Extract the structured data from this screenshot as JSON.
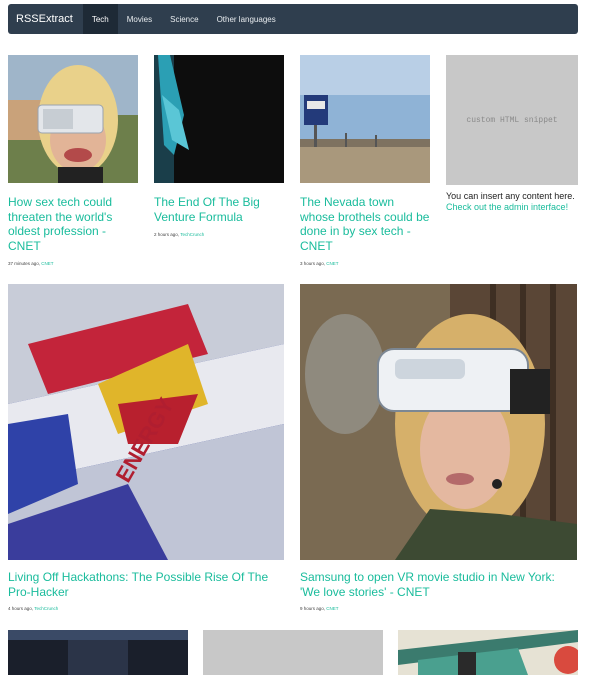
{
  "navbar": {
    "brand": "RSSExtract",
    "items": [
      {
        "label": "Tech"
      },
      {
        "label": "Movies"
      },
      {
        "label": "Science"
      },
      {
        "label": "Other languages"
      }
    ]
  },
  "articles": [
    {
      "title": "How sex tech could threaten the world's oldest profession - CNET",
      "time": "37 minutes ago,",
      "source": "CNET"
    },
    {
      "title": "The End Of The Big Venture Formula",
      "time": "2 hours ago,",
      "source": "TechCrunch"
    },
    {
      "title": "The Nevada town whose brothels could be done in by sex tech - CNET",
      "time": "3 hours ago,",
      "source": "CNET"
    },
    {
      "title": "Living Off Hackathons: The Possible Rise Of The Pro-Hacker",
      "time": "4 hours ago,",
      "source": "TechCrunch"
    },
    {
      "title": "Samsung to open VR movie studio in New York: 'We love stories' - CNET",
      "time": "9 hours ago,",
      "source": "CNET"
    }
  ],
  "snippet": {
    "label": "custom HTML snippet",
    "text": "You can insert any content here.",
    "link": "Check out the admin interface!"
  },
  "colors": {
    "accent": "#1abc9c",
    "navbar": "#2f3e4e",
    "placeholder": "#c8c8c8"
  }
}
